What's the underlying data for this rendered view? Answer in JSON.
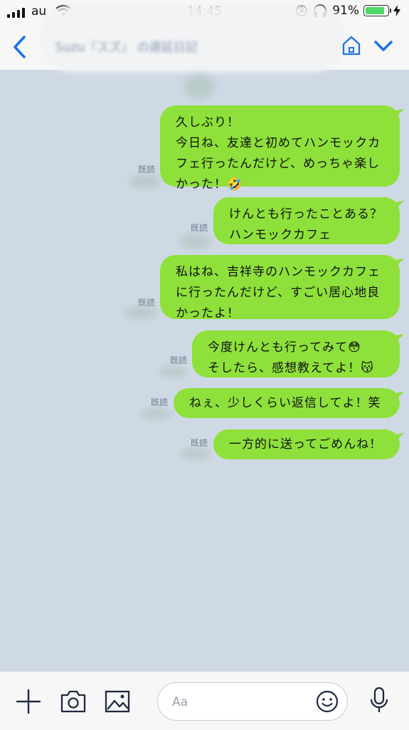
{
  "status_bar": {
    "carrier": "au",
    "time": "14:45",
    "battery": "91%",
    "battery_level": 0.91
  },
  "nav": {
    "title": "Suzu『スズ』 の遅延日記",
    "icons": [
      "chevron-left-icon",
      "home-icon",
      "chevron-down-icon"
    ]
  },
  "messages": [
    {
      "text": "久しぶり！\n今日ね、友達と初めてハンモックカ\nフェ行ったんだけど、めっちゃ楽し\nかった！🤣",
      "read": "既読"
    },
    {
      "text": "けんとも行ったことある？\nハンモックカフェ",
      "read": "既読"
    },
    {
      "text": "私はね、吉祥寺のハンモックカフェ\nに行ったんだけど、すごい居心地良\nかったよ！",
      "read": "既読"
    },
    {
      "text": "今度けんとも行ってみて😳\nそしたら、感想教えてよ！😽",
      "read": "既読"
    },
    {
      "text": "ねぇ、少しくらい返信してよ！笑",
      "read": "既読"
    },
    {
      "text": "一方的に送ってごめんね！",
      "read": "既読"
    }
  ],
  "input_bar": {
    "placeholder": "Aa",
    "icons": [
      "plus-icon",
      "camera-icon",
      "image-icon",
      "emoji-icon",
      "microphone-icon"
    ]
  },
  "colors": {
    "bubble": "#8ee13a",
    "chat_background": "#cfd9e5",
    "accent": "#1a73e8"
  }
}
